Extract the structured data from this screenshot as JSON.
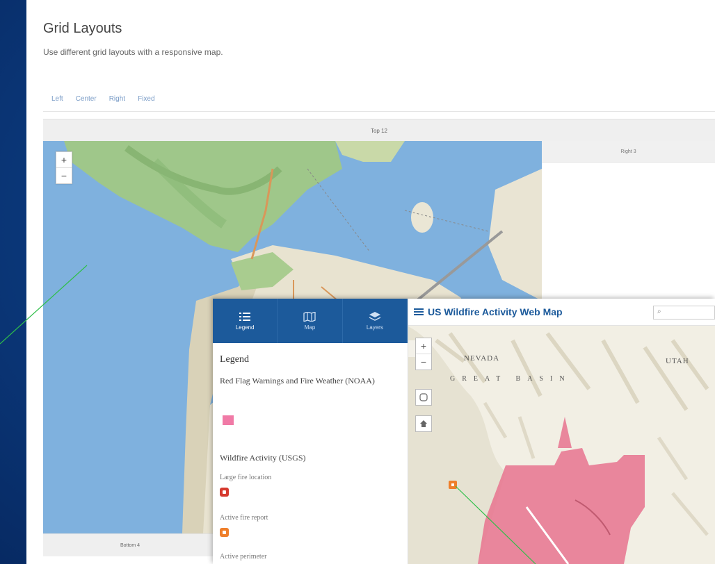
{
  "page": {
    "title": "Grid Layouts",
    "subtitle": "Use different grid layouts with a responsive map."
  },
  "tabs": [
    {
      "label": "Left"
    },
    {
      "label": "Center"
    },
    {
      "label": "Right"
    },
    {
      "label": "Fixed"
    }
  ],
  "layout": {
    "top_label": "Top 12",
    "right_label": "Right 3",
    "bottom_label": "Bottom 4"
  },
  "sf_map": {
    "zoom_in": "+",
    "zoom_out": "−"
  },
  "sidebar": {
    "tabs": [
      {
        "label": "Legend",
        "icon": "legend-icon"
      },
      {
        "label": "Map",
        "icon": "map-icon"
      },
      {
        "label": "Layers",
        "icon": "layers-icon"
      }
    ],
    "legend_title": "Legend",
    "layer1_title": "Red Flag Warnings and Fire Weather (NOAA)",
    "layer1_color": "#f07aa6",
    "layer2_title": "Wildfire Activity (USGS)",
    "items": [
      {
        "label": "Large fire location",
        "color": "#d63a2f"
      },
      {
        "label": "Active fire report",
        "color": "#ef7f2b"
      },
      {
        "label": "Active perimeter",
        "color": "#ef7f2b"
      }
    ]
  },
  "wildfire_map": {
    "title": "US Wildfire Activity Web Map",
    "search_icon": "search-icon",
    "zoom_in": "+",
    "zoom_out": "−",
    "labels": [
      "NEVADA",
      "UTAH",
      "GREAT BASIN"
    ],
    "colors": {
      "warning_area": "#e8738f",
      "brand": "#1c5a9b"
    }
  }
}
